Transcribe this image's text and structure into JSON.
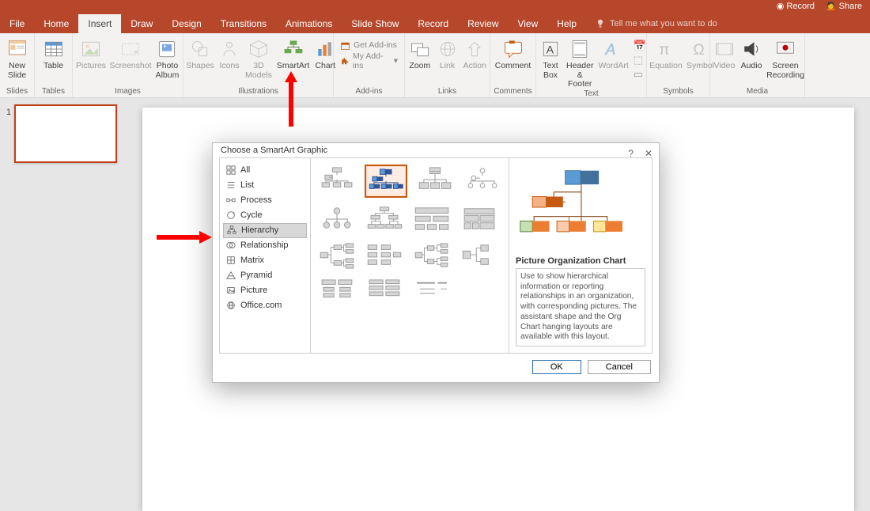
{
  "titlebar": {
    "record": "Record",
    "share": "Share"
  },
  "tabs": [
    "File",
    "Home",
    "Insert",
    "Draw",
    "Design",
    "Transitions",
    "Animations",
    "Slide Show",
    "Record",
    "Review",
    "View",
    "Help"
  ],
  "tellme_placeholder": "Tell me what you want to do",
  "ribbon": {
    "slides": {
      "group_label": "Slides",
      "new_slide": "New\nSlide"
    },
    "tables": {
      "group_label": "Tables",
      "table": "Table"
    },
    "images": {
      "group_label": "Images",
      "pictures": "Pictures",
      "screenshot": "Screenshot",
      "photo_album": "Photo\nAlbum"
    },
    "illustrations": {
      "group_label": "Illustrations",
      "shapes": "Shapes",
      "icons": "Icons",
      "models": "3D\nModels",
      "smartart": "SmartArt",
      "chart": "Chart"
    },
    "addins": {
      "group_label": "Add-ins",
      "get": "Get Add-ins",
      "my": "My Add-ins"
    },
    "links": {
      "group_label": "Links",
      "zoom": "Zoom",
      "link": "Link",
      "action": "Action"
    },
    "comments": {
      "group_label": "Comments",
      "comment": "Comment"
    },
    "text": {
      "group_label": "Text",
      "textbox": "Text\nBox",
      "headerfooter": "Header\n& Footer",
      "wordart": "WordArt"
    },
    "symbols": {
      "group_label": "Symbols",
      "equation": "Equation",
      "symbol": "Symbol"
    },
    "media": {
      "group_label": "Media",
      "video": "Video",
      "audio": "Audio",
      "recording": "Screen\nRecording"
    }
  },
  "thumbs": {
    "slide1_num": "1"
  },
  "dialog": {
    "title": "Choose a SmartArt Graphic",
    "categories": [
      "All",
      "List",
      "Process",
      "Cycle",
      "Hierarchy",
      "Relationship",
      "Matrix",
      "Pyramid",
      "Picture",
      "Office.com"
    ],
    "selected_category_index": 4,
    "preview_title": "Picture Organization Chart",
    "preview_desc": "Use to show hierarchical information or reporting relationships in an organization, with corresponding pictures. The assistant shape and the Org Chart hanging layouts are available with this layout.",
    "ok": "OK",
    "cancel": "Cancel"
  }
}
